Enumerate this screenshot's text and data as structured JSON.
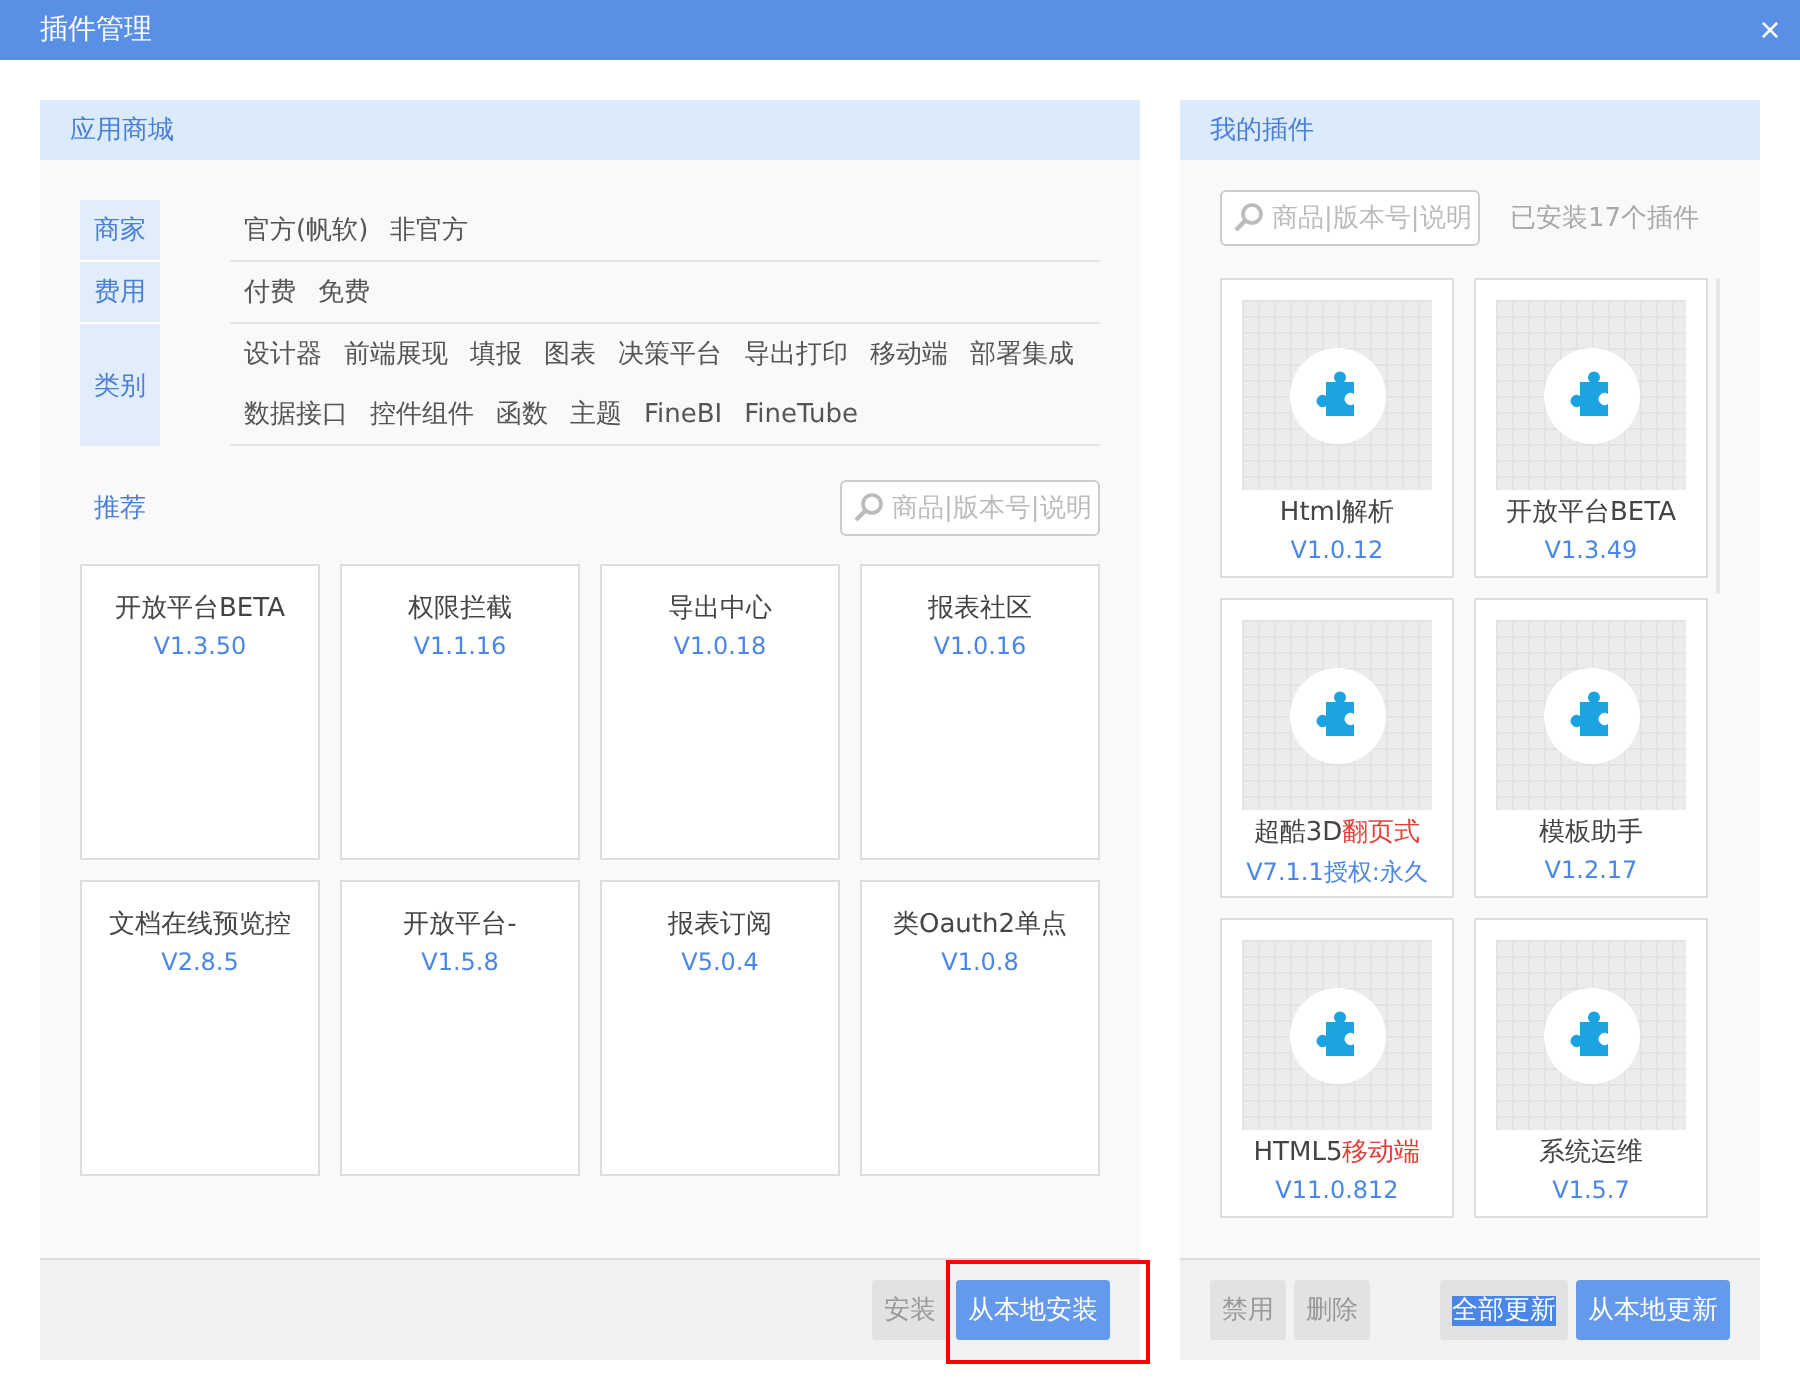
{
  "window": {
    "title": "插件管理",
    "close": "×"
  },
  "store": {
    "title": "应用商城",
    "filters": [
      {
        "label": "商家",
        "rows": [
          [
            "官方(帆软)",
            "非官方"
          ]
        ]
      },
      {
        "label": "费用",
        "rows": [
          [
            "付费",
            "免费"
          ]
        ]
      },
      {
        "label": "类别",
        "rows": [
          [
            "设计器",
            "前端展现",
            "填报",
            "图表",
            "决策平台",
            "导出打印",
            "移动端",
            "部署集成"
          ],
          [
            "数据接口",
            "控件组件",
            "函数",
            "主题",
            "FineBI",
            "FineTube"
          ]
        ]
      }
    ],
    "recommend": "推荐",
    "search": {
      "placeholder": "商品|版本号|说明"
    },
    "cards": [
      {
        "name": "开放平台BETA",
        "version": "V1.3.50"
      },
      {
        "name": "权限拦截",
        "version": "V1.1.16"
      },
      {
        "name": "导出中心",
        "version": "V1.0.18"
      },
      {
        "name": "报表社区",
        "version": "V1.0.16"
      },
      {
        "name": "文档在线预览控",
        "version": "V2.8.5"
      },
      {
        "name": "开放平台-",
        "version": "V1.5.8"
      },
      {
        "name": "报表订阅",
        "version": "V5.0.4"
      },
      {
        "name": "类Oauth2单点",
        "version": "V1.0.8"
      }
    ],
    "buttons": [
      {
        "label": "安装",
        "kind": "disabled",
        "highlighted": false
      },
      {
        "label": "从本地安装",
        "kind": "primary",
        "highlighted": true
      }
    ]
  },
  "mine": {
    "title": "我的插件",
    "search": {
      "placeholder": "商品|版本号|说明"
    },
    "count": "已安装17个插件",
    "plugins": [
      {
        "name": "Html解析",
        "version": "V1.0.12"
      },
      {
        "name": "开放平台BETA",
        "version": "V1.3.49"
      },
      {
        "name": "超酷3D",
        "name_red": "翻页式",
        "version": "V7.1.1授权:永久"
      },
      {
        "name": "模板助手",
        "version": "V1.2.17"
      },
      {
        "name": "HTML5",
        "name_red": "移动端",
        "version": "V11.0.812"
      },
      {
        "name": "系统运维",
        "version": "V1.5.7"
      }
    ],
    "buttons": [
      {
        "label": "禁用",
        "kind": "disabled",
        "text_selected": false
      },
      {
        "label": "删除",
        "kind": "disabled",
        "text_selected": false
      },
      {
        "label": "全部更新",
        "kind": "disabled",
        "text_selected": true
      },
      {
        "label": "从本地更新",
        "kind": "primary",
        "text_selected": false
      }
    ]
  }
}
